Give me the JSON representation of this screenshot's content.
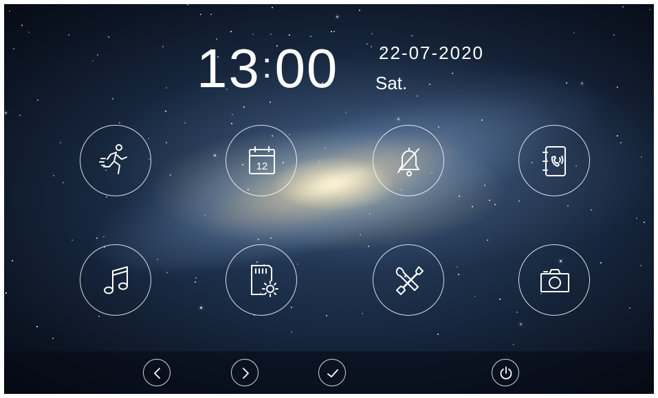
{
  "clock": {
    "hours": "13",
    "separator": ":",
    "minutes": "00"
  },
  "date": {
    "value": "22-07-2020",
    "weekday": "Sat."
  },
  "menu": [
    {
      "icon": "motion-detection-icon"
    },
    {
      "icon": "calendar-icon",
      "day": "12"
    },
    {
      "icon": "do-not-disturb-bell-icon"
    },
    {
      "icon": "intercom-phonebook-icon"
    },
    {
      "icon": "music-icon"
    },
    {
      "icon": "sd-card-settings-icon"
    },
    {
      "icon": "tools-settings-icon"
    },
    {
      "icon": "camera-icon"
    }
  ],
  "bottom_bar": [
    {
      "icon": "chevron-left-icon"
    },
    {
      "icon": "chevron-right-icon"
    },
    {
      "icon": "checkmark-icon"
    },
    {
      "icon": "power-icon"
    }
  ]
}
